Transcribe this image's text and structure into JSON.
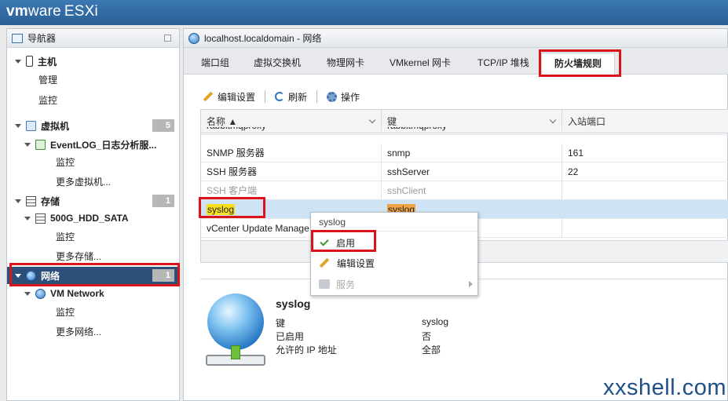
{
  "header": {
    "brand_vm": "vm",
    "brand_ware": "ware",
    "brand_product": "ESXi"
  },
  "navigator": {
    "title": "导航器",
    "items": [
      {
        "label": "主机",
        "badge": ""
      },
      {
        "label": "管理",
        "badge": ""
      },
      {
        "label": "监控",
        "badge": ""
      },
      {
        "label": "虚拟机",
        "badge": "5"
      },
      {
        "label": "EventLOG_日志分析服...",
        "badge": ""
      },
      {
        "label": "监控",
        "badge": ""
      },
      {
        "label": "更多虚拟机...",
        "badge": ""
      },
      {
        "label": "存储",
        "badge": "1"
      },
      {
        "label": "500G_HDD_SATA",
        "badge": ""
      },
      {
        "label": "监控",
        "badge": ""
      },
      {
        "label": "更多存储...",
        "badge": ""
      },
      {
        "label": "网络",
        "badge": "1"
      },
      {
        "label": "VM Network",
        "badge": ""
      },
      {
        "label": "监控",
        "badge": ""
      },
      {
        "label": "更多网络...",
        "badge": ""
      }
    ]
  },
  "main": {
    "title": "localhost.localdomain - 网络",
    "tabs": [
      "端口组",
      "虚拟交换机",
      "物理网卡",
      "VMkernel 网卡",
      "TCP/IP 堆栈",
      "防火墙规则"
    ],
    "active_tab": "防火墙规则",
    "toolbar": {
      "edit": "编辑设置",
      "refresh": "刷新",
      "actions": "操作"
    },
    "table": {
      "headers": [
        "名称 ▲",
        "键",
        "入站端口"
      ],
      "rows": [
        {
          "name": "rabbitmqproxy",
          "key": "rabbitmqproxy",
          "port": ""
        },
        {
          "name": "SNMP 服务器",
          "key": "snmp",
          "port": "161"
        },
        {
          "name": "SSH 服务器",
          "key": "sshServer",
          "port": "22"
        },
        {
          "name": "SSH 客户端",
          "key": "sshClient",
          "port": ""
        },
        {
          "name": "syslog",
          "key": "syslog",
          "port": ""
        },
        {
          "name": "vCenter Update Manage",
          "key": "",
          "port": ""
        }
      ]
    }
  },
  "context_menu": {
    "title": "syslog",
    "items": [
      "启用",
      "编辑设置",
      "服务"
    ]
  },
  "details": {
    "title": "syslog",
    "fields": [
      {
        "label": "键",
        "value": "syslog"
      },
      {
        "label": "已启用",
        "value": "否"
      },
      {
        "label": "允许的 IP 地址",
        "value": "全部"
      }
    ]
  },
  "watermark": "xxshell.com",
  "colors": {
    "header": "#2f6aa5",
    "selected_nav": "#2c4f7a",
    "highlight_box": "#d9141a",
    "row_highlight": "#cfe3f7"
  }
}
